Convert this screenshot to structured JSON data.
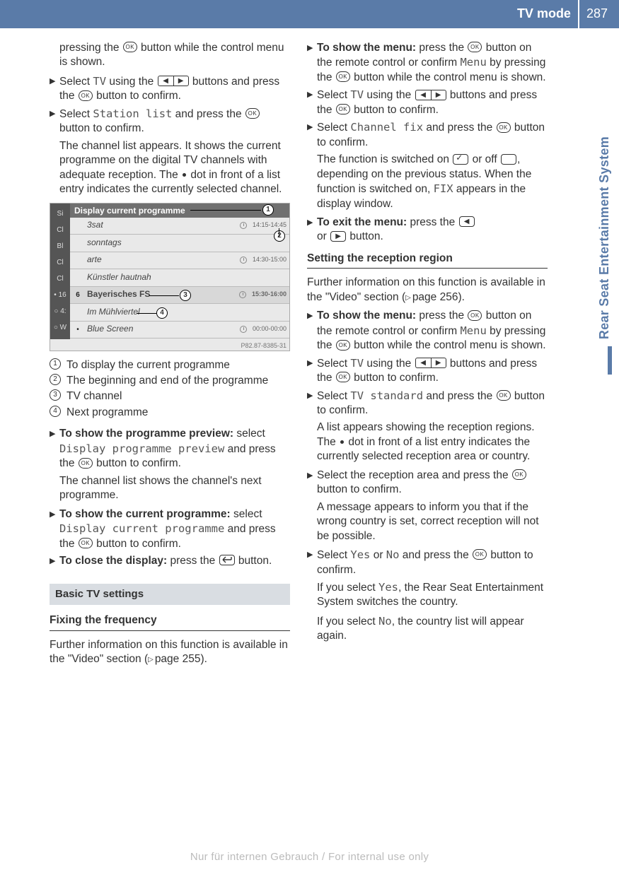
{
  "header": {
    "title": "TV mode",
    "page": "287"
  },
  "side_tab": "Rear Seat Entertainment System",
  "col_left": {
    "intro": "pressing the ⊛ button while the control menu is shown.",
    "step1_a": "Select ",
    "step1_tv": "TV",
    "step1_b": " using the ",
    "step1_c": " buttons and press the ",
    "step1_d": " button to confirm.",
    "step2_a": "Select ",
    "step2_station": "Station list",
    "step2_b": " and press the ",
    "step2_c": " button to confirm.",
    "step2_res": "The channel list appears. It shows the cur­rent programme on the digital TV channels with adequate reception. The ",
    "step2_res2": " dot in front of a list entry indicates the currently selected channel.",
    "screenshot": {
      "header": "Display current programme",
      "leftstrip": [
        "Si",
        "Cl",
        "Bl",
        "Cl",
        "Cl",
        "• 16",
        "○ 4:",
        "○ W"
      ],
      "rows": [
        {
          "ch": "",
          "name": "3sat",
          "time": "14:15-14:45",
          "sel": false,
          "clock": true
        },
        {
          "ch": "",
          "name": "sonntags",
          "time": "",
          "sel": false,
          "clock": false
        },
        {
          "ch": "",
          "name": "arte",
          "time": "14:30-15:00",
          "sel": false,
          "clock": true
        },
        {
          "ch": "",
          "name": "Künstler hautnah",
          "time": "",
          "sel": false,
          "clock": false
        },
        {
          "ch": "6",
          "name": "Bayerisches FS",
          "time": "15:30-16:00",
          "sel": true,
          "clock": true
        },
        {
          "ch": "",
          "name": "Im Mühlviertel",
          "time": "",
          "sel": false,
          "clock": false
        },
        {
          "ch": "•",
          "name": "Blue Screen",
          "time": "00:00-00:00",
          "sel": false,
          "clock": true
        }
      ],
      "footer": "P82.87-8385-31"
    },
    "legend": [
      "To display the current programme",
      "The beginning and end of the programme",
      "TV channel",
      "Next programme"
    ],
    "st_preview_l": "To show the programme preview:",
    "st_preview_a": " select ",
    "st_preview_m": "Display programme preview",
    "st_preview_b": " and press the ",
    "st_preview_c": " button to confirm.",
    "st_preview_r": "The channel list shows the channel's next programme.",
    "st_current_l": "To show the current programme:",
    "st_current_a": " select ",
    "st_current_m": "Display current programme",
    "st_current_b": " and press the ",
    "st_current_c": " button to confirm.",
    "st_close_l": "To close the display:",
    "st_close_a": " press the ",
    "st_close_b": " but­ton.",
    "sec_bar": "Basic TV settings",
    "subh1": "Fixing the frequency",
    "subh1_p": "Further information on this function is avail­able in the \"Video\" section (▷ page 255)."
  },
  "col_right": {
    "menu_l": "To show the menu:",
    "menu_a": " press the ",
    "menu_b": " button on the remote control or confirm ",
    "menu_m": "Menu",
    "menu_c": " by pressing the ",
    "menu_d": " button while the control menu is shown.",
    "tv_a": "Select ",
    "tv_tv": "TV",
    "tv_b": " using the ",
    "tv_c": " buttons and press the ",
    "tv_d": " button to confirm.",
    "cf_a": "Select ",
    "cf_m": "Channel fix",
    "cf_b": " and press the ",
    "cf_c": " but­ton to confirm.",
    "cf_r1": "The function is switched on ",
    "cf_r2": " or off ",
    "cf_r3": ", depending on the previous status. When the function is switched on, ",
    "cf_fix": "FIX",
    "cf_r4": " appears in the display window.",
    "exit_l": "To exit the menu:",
    "exit_a": " press the ",
    "exit_b": " or ",
    "exit_c": " button.",
    "subh2": "Setting the reception region",
    "subh2_p": "Further information on this function is avail­able in the \"Video\" section (▷ page 256).",
    "ts_a": "Select ",
    "ts_m": "TV standard",
    "ts_b": " and press the ",
    "ts_c": " but­ton to confirm.",
    "ts_r": "A list appears showing the reception regions. The ",
    "ts_r2": " dot in front of a list entry indicates the currently selected reception area or country.",
    "ra_a": "Select the reception area and press the ",
    "ra_b": " button to confirm.",
    "ra_r": "A message appears to inform you that if the wrong country is set, correct reception will not be possible.",
    "yn_a": "Select ",
    "yn_yes": "Yes",
    "yn_or": " or ",
    "yn_no": "No",
    "yn_b": " and press the ",
    "yn_c": " button to confirm.",
    "yn_r1a": "If you select ",
    "yn_r1b": ", the Rear Seat Entertain­ment System switches the country.",
    "yn_r2a": "If you select ",
    "yn_r2b": ", the country list will appear again."
  },
  "watermark": "Nur für internen Gebrauch / For internal use only"
}
